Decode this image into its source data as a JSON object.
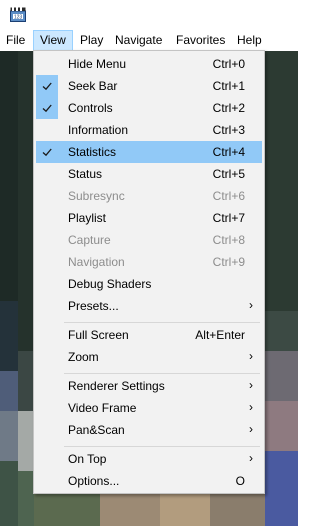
{
  "menubar": {
    "items": [
      {
        "label": "File"
      },
      {
        "label": "View"
      },
      {
        "label": "Play"
      },
      {
        "label": "Navigate"
      },
      {
        "label": "Favorites"
      },
      {
        "label": "Help"
      }
    ]
  },
  "view_menu": {
    "items": [
      {
        "label": "Hide Menu",
        "shortcut": "Ctrl+0"
      },
      {
        "label": "Seek Bar",
        "shortcut": "Ctrl+1",
        "checked": true
      },
      {
        "label": "Controls",
        "shortcut": "Ctrl+2",
        "checked": true
      },
      {
        "label": "Information",
        "shortcut": "Ctrl+3"
      },
      {
        "label": "Statistics",
        "shortcut": "Ctrl+4",
        "checked": true,
        "highlighted": true
      },
      {
        "label": "Status",
        "shortcut": "Ctrl+5"
      },
      {
        "label": "Subresync",
        "shortcut": "Ctrl+6",
        "disabled": true
      },
      {
        "label": "Playlist",
        "shortcut": "Ctrl+7"
      },
      {
        "label": "Capture",
        "shortcut": "Ctrl+8",
        "disabled": true
      },
      {
        "label": "Navigation",
        "shortcut": "Ctrl+9",
        "disabled": true
      },
      {
        "label": "Debug Shaders",
        "shortcut": ""
      },
      {
        "label": "Presets...",
        "submenu": true
      },
      {
        "label": "Full Screen",
        "shortcut": "Alt+Enter"
      },
      {
        "label": "Zoom",
        "submenu": true
      },
      {
        "label": "Renderer Settings",
        "submenu": true
      },
      {
        "label": "Video Frame",
        "submenu": true
      },
      {
        "label": "Pan&Scan",
        "submenu": true
      },
      {
        "label": "On Top",
        "submenu": true
      },
      {
        "label": "Options...",
        "shortcut": "O"
      }
    ]
  },
  "colors": {
    "highlight": "#91c9f7",
    "menu_bg": "#f2f2f2",
    "active_menubar": "#cce8ff",
    "disabled_text": "#8d8d8d"
  },
  "icons": {
    "app": "media-player-clapper-icon",
    "check": "checkmark-icon",
    "submenu": "chevron-right-icon"
  }
}
